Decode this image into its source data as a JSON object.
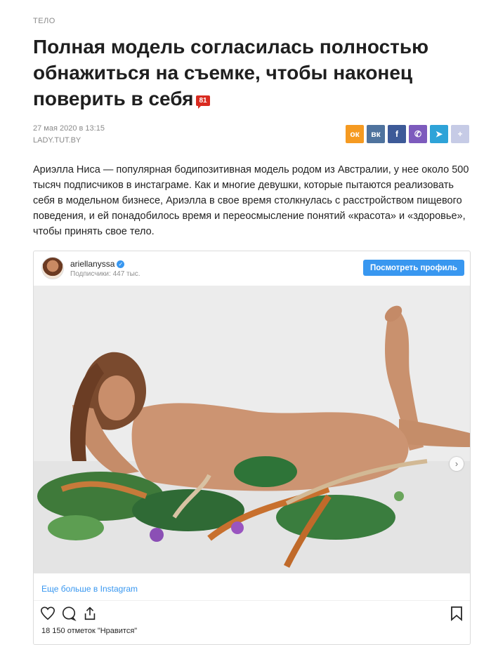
{
  "article": {
    "category": "ТЕЛО",
    "title": "Полная модель согласилась полностью обнажиться на съемке, чтобы наконец поверить в себя",
    "comments_count": "81",
    "date": "27 мая 2020 в 13:15",
    "source": "LADY.TUT.BY",
    "lead": "Ариэлла Ниса — популярная бодипозитивная модель родом из Австралии, у нее около 500 тысяч подписчиков в инстаграме. Как и многие девушки, которые пытаются реализовать себя в модельном бизнесе, Ариэлла в свое время столкнулась с расстройством пищевого поведения, и ей понадобилось время и переосмысление понятий «красота» и «здоровье», чтобы принять свое тело."
  },
  "share": [
    {
      "name": "odnoklassniki-icon",
      "glyph": "ок",
      "color": "#f59a21"
    },
    {
      "name": "vk-icon",
      "glyph": "вк",
      "color": "#4f739e"
    },
    {
      "name": "facebook-icon",
      "glyph": "f",
      "color": "#3d5a98"
    },
    {
      "name": "viber-icon",
      "glyph": "✆",
      "color": "#7d5bbd"
    },
    {
      "name": "telegram-icon",
      "glyph": "➤",
      "color": "#2ea3d8"
    },
    {
      "name": "more-share-icon",
      "glyph": "+",
      "color": "#c6cbe6"
    }
  ],
  "instagram": {
    "username": "ariellanyssa",
    "verified_glyph": "✓",
    "followers": "Подписчики: 447 тыс.",
    "view_profile": "Посмотреть профиль",
    "more_link": "Еще больше в Instagram",
    "next_glyph": "›",
    "likes": "18 150 отметок \"Нравится\""
  }
}
